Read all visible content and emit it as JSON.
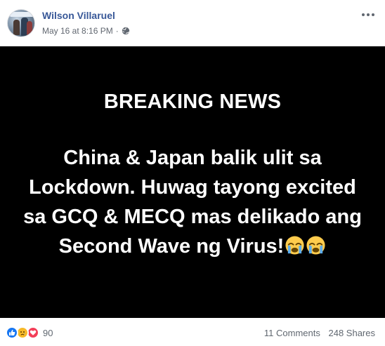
{
  "post": {
    "author": "Wilson Villaruel",
    "timestamp": "May 16 at 8:16 PM",
    "separator": "·",
    "privacy_icon": "globe-icon",
    "menu_icon": "more-options-icon"
  },
  "content": {
    "headline": "BREAKING NEWS",
    "message": "China & Japan balik ulit sa Lockdown. Huwag tayong excited sa GCQ & MECQ mas delikado ang Second Wave ng Virus!",
    "emojis": [
      "crying-face-emoji",
      "crying-face-emoji"
    ],
    "background_color": "#000000",
    "text_color": "#ffffff"
  },
  "engagement": {
    "reactions": [
      "like-icon",
      "sad-icon",
      "love-icon"
    ],
    "reaction_count": "90",
    "comments": "11 Comments",
    "shares": "248 Shares"
  },
  "colors": {
    "author_link": "#385898",
    "like": "#1877f2",
    "sad": "#f7b928",
    "love": "#f33e58",
    "meta_text": "#606770"
  }
}
